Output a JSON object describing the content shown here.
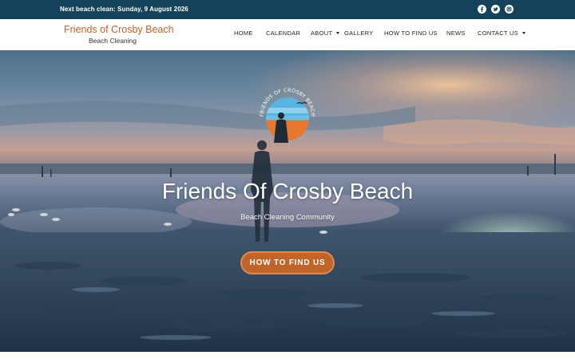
{
  "topbar": {
    "notice": "Next beach clean: Sunday, 9 August 2026",
    "social": [
      {
        "icon": "facebook-icon"
      },
      {
        "icon": "twitter-icon"
      },
      {
        "icon": "instagram-icon"
      }
    ],
    "background": "#14425a"
  },
  "header": {
    "site_name": "Friends of Crosby Beach",
    "tagline": "Beach Cleaning",
    "nav": [
      {
        "label": "HOME"
      },
      {
        "label": "CALENDAR"
      },
      {
        "label": "ABOUT",
        "has_dropdown": true
      },
      {
        "label": "GALLERY"
      },
      {
        "label": "HOW TO FIND US"
      },
      {
        "label": "NEWS"
      },
      {
        "label": "CONTACT US",
        "has_dropdown": true
      }
    ]
  },
  "hero": {
    "logo_text": "FRIENDS OF CROSBY BEACH",
    "title": "Friends Of Crosby Beach",
    "subtitle": "Beach Cleaning Community",
    "button_label": "HOW TO FIND US"
  },
  "colors": {
    "accent": "#c0652a",
    "topbar": "#14425a",
    "text": "#222222"
  }
}
